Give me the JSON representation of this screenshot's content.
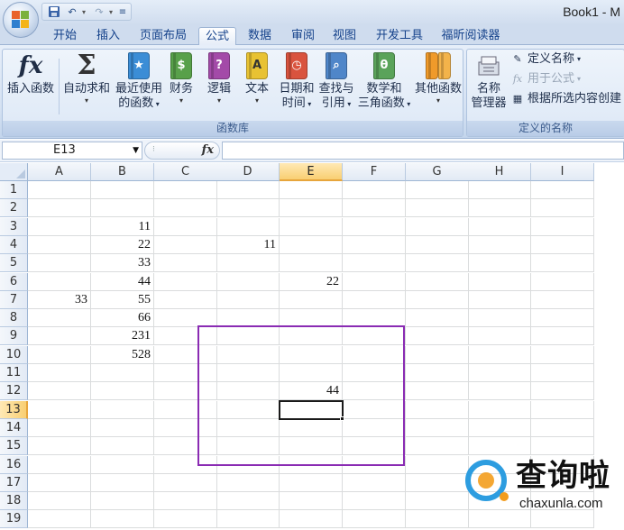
{
  "window": {
    "title": "Book1 - M"
  },
  "quick_access": {
    "save_icon": "save-icon",
    "undo_icon": "undo-icon",
    "redo_icon": "redo-icon",
    "customize_icon": "customize-icon"
  },
  "tabs": [
    {
      "label": "开始",
      "active": false
    },
    {
      "label": "插入",
      "active": false
    },
    {
      "label": "页面布局",
      "active": false
    },
    {
      "label": "公式",
      "active": true
    },
    {
      "label": "数据",
      "active": false
    },
    {
      "label": "审阅",
      "active": false
    },
    {
      "label": "视图",
      "active": false
    },
    {
      "label": "开发工具",
      "active": false
    },
    {
      "label": "福昕阅读器",
      "active": false
    }
  ],
  "ribbon": {
    "function_library": {
      "group_label": "函数库",
      "insert_function": "插入函数",
      "autosum_line1": "自动求和",
      "recent_line1": "最近使用",
      "recent_line2": "的函数",
      "financial": "财务",
      "logical": "逻辑",
      "text": "文本",
      "datetime_line1": "日期和",
      "datetime_line2": "时间",
      "lookup_line1": "查找与",
      "lookup_line2": "引用",
      "math_line1": "数学和",
      "math_line2": "三角函数",
      "more_functions": "其他函数"
    },
    "defined_names": {
      "group_label": "定义的名称",
      "name_manager_line1": "名称",
      "name_manager_line2": "管理器",
      "define_name": "定义名称",
      "use_in_formula": "用于公式",
      "create_from_selection": "根据所选内容创建"
    }
  },
  "formula_bar": {
    "name_box": "E13",
    "fx_label": "fx",
    "formula": ""
  },
  "grid": {
    "columns": [
      "A",
      "B",
      "C",
      "D",
      "E",
      "F",
      "G",
      "H",
      "I"
    ],
    "selected_column": "E",
    "rows": [
      "1",
      "2",
      "3",
      "4",
      "5",
      "6",
      "7",
      "8",
      "9",
      "10",
      "11",
      "12",
      "13",
      "14",
      "15",
      "16",
      "17",
      "18",
      "19"
    ],
    "selected_row": "13",
    "cells": {
      "B3": "11",
      "B4": "22",
      "D4": "11",
      "B5": "33",
      "B6": "44",
      "E6": "22",
      "A7": "33",
      "B7": "55",
      "B8": "66",
      "B9": "231",
      "B10": "528",
      "E12": "44"
    },
    "active_cell": "E13",
    "annotation_color": "#8a2bb3"
  },
  "watermark": {
    "brand_text": "查询啦",
    "domain": "chaxunla.com"
  }
}
